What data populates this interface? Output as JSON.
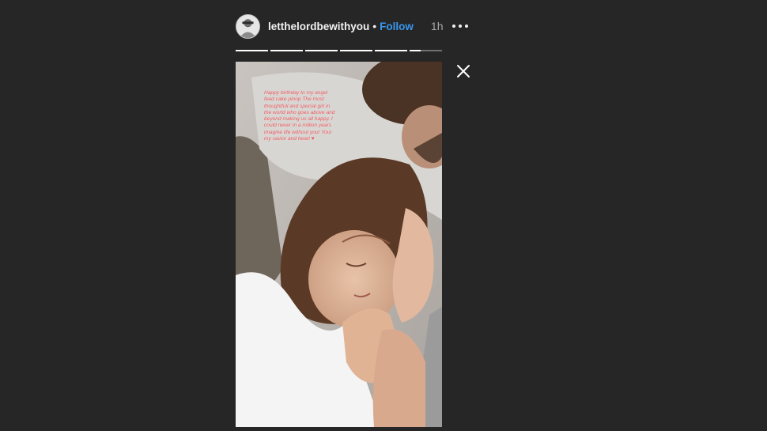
{
  "header": {
    "username": "letthelordbewithyou",
    "separator": "•",
    "follow_label": "Follow",
    "timestamp": "1h",
    "avatar_icon": "profile-photo",
    "more_icon": "more-horizontal-icon"
  },
  "progress": {
    "segments": [
      1,
      1,
      1,
      1,
      1,
      0.35
    ]
  },
  "story": {
    "caption": "Happy birthday to my angel feed cake pinop The most thoughtfull and special girl in the world who goes above and beyond making us all happy. I could never in a million years imagine life without you! Your my savior and heart ♥"
  },
  "close_icon": "close-icon",
  "colors": {
    "background": "#262626",
    "follow": "#3897f0",
    "caption_text": "#e8545a"
  }
}
